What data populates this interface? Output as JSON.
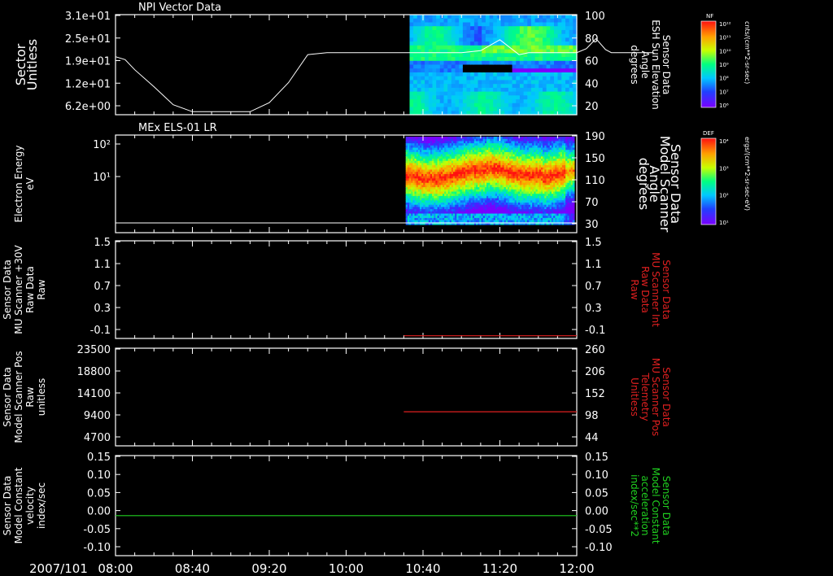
{
  "time_axis": {
    "date_label": "2007/101",
    "range": [
      "08:00",
      "12:00"
    ],
    "tick_labels": [
      "08:00",
      "08:40",
      "09:20",
      "10:00",
      "10:40",
      "11:20",
      "12:00"
    ]
  },
  "chart_data": [
    {
      "type": "line+heatmap",
      "title": "NPI Vector Data",
      "ylabel_left": [
        "Sector",
        "Unitless"
      ],
      "ylabel_right": [
        "Sensor Data",
        "ESH Sun Elevation",
        "Angle",
        "degrees"
      ],
      "left_ticks": [
        "3.1e+01",
        "2.5e+01",
        "1.9e+01",
        "1.2e+01",
        "6.2e+00"
      ],
      "right_ticks": [
        "100",
        "80",
        "60",
        "40",
        "20"
      ],
      "right_ylim": [
        0,
        100
      ],
      "spectrogram_start": "10:33",
      "line_series": {
        "x_min": [
          0,
          5,
          10,
          20,
          30,
          40,
          50,
          60,
          70,
          80,
          90,
          100,
          110,
          120,
          140,
          160,
          180,
          190,
          200,
          210,
          215,
          220,
          225,
          230,
          240,
          245,
          250,
          255,
          258,
          261,
          264,
          267,
          270,
          273,
          276,
          279,
          280
        ],
        "y_deg": [
          58,
          55,
          45,
          28,
          10,
          3,
          3,
          3,
          3,
          12,
          32,
          60,
          62,
          62,
          62,
          62,
          62,
          64,
          75,
          60,
          62,
          62,
          62,
          62,
          62,
          66,
          76,
          65,
          62,
          62,
          62,
          62,
          62,
          62,
          62,
          62,
          62
        ]
      },
      "colorbar": {
        "name": "NF",
        "units": "cnts/(cm**2-sr-sec)",
        "ticks": [
          "10¹²",
          "10¹¹",
          "10¹⁰",
          "10⁹",
          "10⁸",
          "10⁷",
          "10⁶"
        ]
      }
    },
    {
      "type": "heatmap",
      "title": "MEx ELS-01 LR",
      "ylabel_left": [
        "Electron Energy",
        "eV"
      ],
      "ylabel_right": [
        "Sensor Data",
        "Model Scanner",
        "Angle",
        "degrees"
      ],
      "left_ticks": [
        "10²",
        "10¹"
      ],
      "right_ticks": [
        "190",
        "150",
        "110",
        "70",
        "30"
      ],
      "spectrogram_start": "10:31",
      "colorbar": {
        "name": "DEF",
        "units": "ergs/(cm**2-sr-sec-eV)",
        "ticks": [
          "10⁴",
          "10³",
          "10²",
          "10¹"
        ]
      }
    },
    {
      "type": "line",
      "ylabel_left": [
        "Sensor Data",
        "MU Scanner +30V",
        "Raw Data",
        "Raw"
      ],
      "ylabel_right": [
        "Sensor Data",
        "MU Scanner Int",
        "Raw Data",
        "Raw"
      ],
      "left_ticks": [
        "1.5",
        "1.1",
        "0.7",
        "0.3",
        "-0.1"
      ],
      "right_ticks": [
        "1.5",
        "1.1",
        "0.7",
        "0.3",
        "-0.1"
      ],
      "ylim": [
        -0.3,
        1.5
      ],
      "series": [
        {
          "color": "#e02020",
          "x": [
            "10:30",
            "12:00"
          ],
          "y": [
            -0.25,
            -0.25
          ]
        }
      ]
    },
    {
      "type": "line",
      "ylabel_left": [
        "Sensor Data",
        "Model Scanner Pos",
        "Raw",
        "unitless"
      ],
      "ylabel_right": [
        "Sensor Data",
        "MU Scanner Pos",
        "Telemetry",
        "Unitless"
      ],
      "left_ticks": [
        "23500",
        "18800",
        "14100",
        "9400",
        "4700"
      ],
      "right_ticks": [
        "260",
        "206",
        "152",
        "98",
        "44"
      ],
      "ylim": [
        0,
        23500
      ],
      "series": [
        {
          "color": "#e02020",
          "x": [
            "10:30",
            "12:00"
          ],
          "y": [
            8200,
            8200
          ]
        }
      ]
    },
    {
      "type": "line",
      "ylabel_left": [
        "Sensor Data",
        "Model Constant",
        "velocity",
        "index/sec"
      ],
      "ylabel_right": [
        "Sensor Data",
        "Model Constant",
        "acceleration",
        "index/sec**2"
      ],
      "left_ticks": [
        "0.15",
        "0.10",
        "0.05",
        "0.00",
        "-0.05",
        "-0.10"
      ],
      "right_ticks": [
        "0.15",
        "0.10",
        "0.05",
        "0.00",
        "-0.05",
        "-0.10"
      ],
      "ylim": [
        -0.1,
        0.15
      ],
      "series": [
        {
          "color": "#20d020",
          "x": [
            "08:00",
            "12:00"
          ],
          "y": [
            0,
            0
          ]
        }
      ]
    }
  ]
}
